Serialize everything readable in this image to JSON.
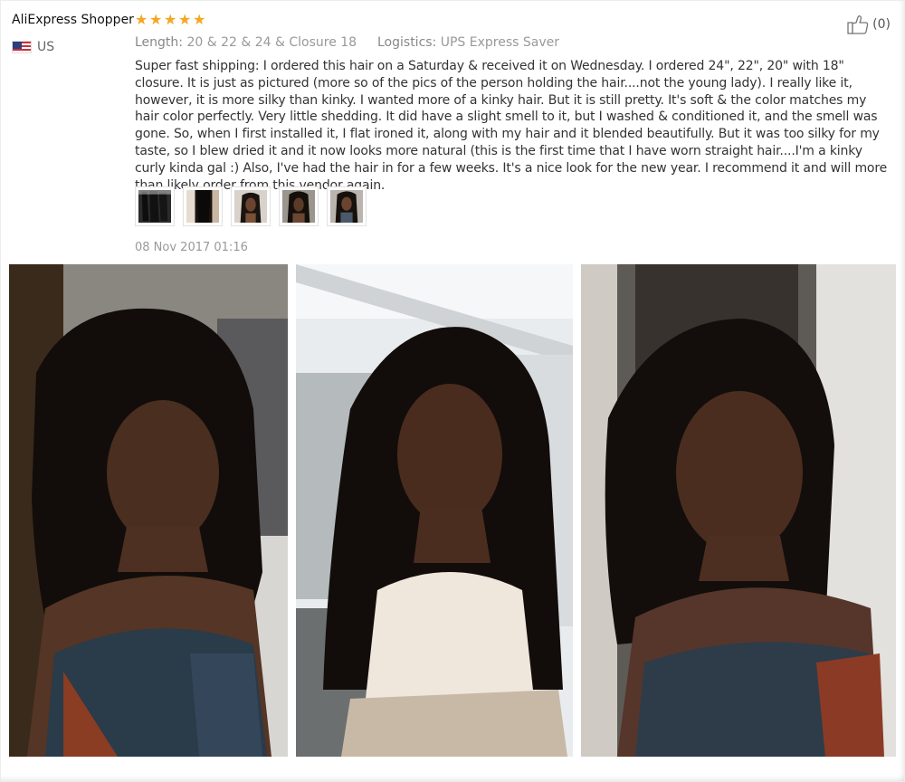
{
  "review": {
    "reviewer_name": "AliExpress Shopper",
    "country": "US",
    "rating_stars": 5,
    "likes_count": "(0)",
    "length_label": "Length:",
    "length_value": "20 & 22 & 24 & Closure 18",
    "logistics_label": "Logistics:",
    "logistics_value": "UPS Express Saver",
    "text": "Super fast shipping: I ordered this hair on a Saturday & received it on Wednesday. I ordered 24\", 22\", 20\" with 18\" closure. It is just as pictured (more so of the pics of the person holding the hair....not the young lady). I really like it, however, it is more silky than kinky. I wanted more of a kinky hair. But it is still pretty. It's soft & the color matches my hair color perfectly. Very little shedding. It did have a slight smell to it, but I washed & conditioned it, and the smell was gone. So, when I first installed it, I flat ironed it, along with my hair and it blended beautifully. But it was too silky for my taste, so I blew dried it and it now looks more natural (this is the first time that I have worn straight hair....I'm a kinky curly kinda gal :) Also, I've had the hair in for a few weeks. It's a nice look for the new year. I recommend it and will more than likely order from this vendor again.",
    "date": "08 Nov 2017 01:16"
  },
  "icons": {
    "flag": "us-flag-icon",
    "star": "star-icon",
    "like": "thumbs-up-icon"
  },
  "colors": {
    "star": "#f5a623",
    "muted_text": "#999999",
    "body_text": "#333333"
  },
  "thumbnails_count": 5,
  "photos_count": 3
}
